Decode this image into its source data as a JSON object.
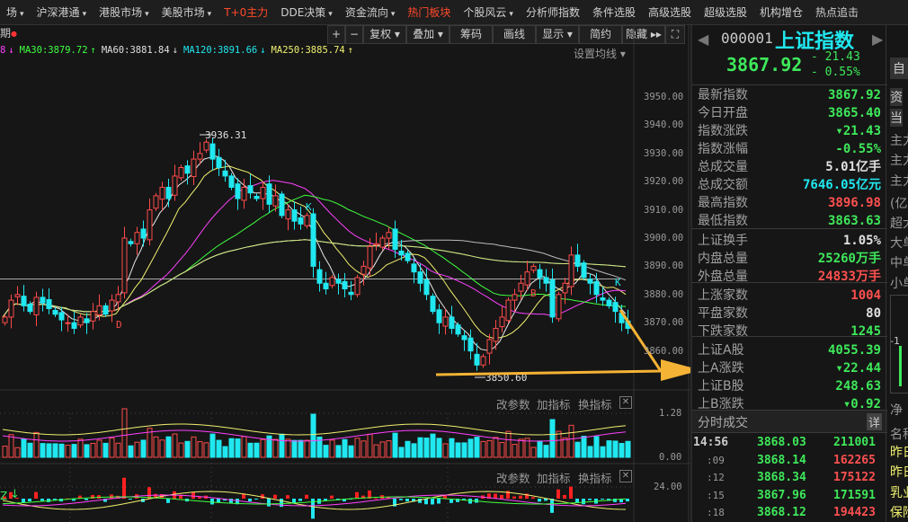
{
  "menu": [
    "场",
    "沪深港通",
    "港股市场",
    "美股市场",
    "T+0主力",
    "DDE决策",
    "资金流向",
    "热门板块",
    "个股风云",
    "分析师指数",
    "条件选股",
    "高级选股",
    "超级选股",
    "机构增仓",
    "热点追击"
  ],
  "menu_dropdown": [
    true,
    true,
    true,
    true,
    false,
    true,
    true,
    false,
    true,
    false,
    false,
    false,
    false,
    false,
    false
  ],
  "menu_highlight": [
    4,
    7
  ],
  "toolbar": {
    "period": "期",
    "plus": "+",
    "minus": "−",
    "fuquan": "复权",
    "overlay": "叠加",
    "chips": "筹码",
    "draw": "画线",
    "display": "显示",
    "simple": "简约",
    "hide": "隐藏",
    "set_ma": "设置均线"
  },
  "ma_legend": [
    {
      "text": "8",
      "color": "#ff40ff",
      "arrow": "↓"
    },
    {
      "text": "MA30:3879.72",
      "color": "#40ff40",
      "arrow": "↑"
    },
    {
      "text": "MA60:3881.84",
      "color": "#e0e0e0",
      "arrow": "↓"
    },
    {
      "text": "MA120:3891.66",
      "color": "#20e8f0",
      "arrow": "↓"
    },
    {
      "text": "MA250:3885.74",
      "color": "#f0f070",
      "arrow": "↑"
    }
  ],
  "price_axis": [
    "3950.00",
    "3940.00",
    "3930.00",
    "3920.00",
    "3910.00",
    "3900.00",
    "3890.00",
    "3880.00",
    "3870.00",
    "3860.00"
  ],
  "chart_data": {
    "type": "candlestick",
    "closes": [
      3872,
      3878,
      3880,
      3876,
      3874,
      3879,
      3877,
      3875,
      3873,
      3871,
      3870,
      3868,
      3872,
      3870,
      3874,
      3876,
      3873,
      3878,
      3880,
      3900,
      3898,
      3902,
      3900,
      3910,
      3915,
      3918,
      3914,
      3922,
      3925,
      3923,
      3928,
      3930,
      3934,
      3928,
      3925,
      3922,
      3918,
      3914,
      3918,
      3916,
      3914,
      3918,
      3912,
      3915,
      3908,
      3910,
      3906,
      3905,
      3908,
      3890,
      3884,
      3882,
      3886,
      3884,
      3882,
      3880,
      3886,
      3890,
      3897,
      3898,
      3900,
      3902,
      3896,
      3894,
      3892,
      3888,
      3884,
      3880,
      3874,
      3870,
      3872,
      3868,
      3866,
      3864,
      3860,
      3855,
      3858,
      3864,
      3868,
      3872,
      3878,
      3880,
      3884,
      3888,
      3890,
      3886,
      3884,
      3872,
      3880,
      3884,
      3894,
      3890,
      3886,
      3884,
      3880,
      3878,
      3876,
      3874,
      3870,
      3868
    ],
    "ylim": [
      3850,
      3955
    ],
    "high_label": "3936.31",
    "low_label": "3850.60",
    "markers": [
      "D",
      "K",
      "K",
      "B"
    ]
  },
  "volume_panel": {
    "axis_top": "1.28",
    "axis_bottom": "0.00",
    "btn_params": "改参数",
    "btn_add": "加指标",
    "btn_switch": "换指标",
    "close": "✕"
  },
  "indicator_panel": {
    "axis_top": "24.00",
    "btn_params": "改参数",
    "btn_add": "加指标",
    "btn_switch": "换指标",
    "close": "✕",
    "left_label": "Z"
  },
  "quote": {
    "code": "000001",
    "name": "上证指数",
    "price": "3867.92",
    "change": "- 21.43",
    "pct": "- 0.55%"
  },
  "stats": [
    {
      "label": "最新指数",
      "value": "3867.92",
      "cls": "g"
    },
    {
      "label": "今日开盘",
      "value": "3865.40",
      "cls": "g"
    },
    {
      "label": "指数涨跌",
      "value": "▾21.43",
      "cls": "g"
    },
    {
      "label": "指数涨幅",
      "value": "-0.55%",
      "cls": "g"
    },
    {
      "label": "总成交量",
      "value": "5.01亿手",
      "cls": "w"
    },
    {
      "label": "总成交额",
      "value": "7646.05亿元",
      "cls": "c"
    },
    {
      "label": "最高指数",
      "value": "3896.98",
      "cls": "r"
    },
    {
      "label": "最低指数",
      "value": "3863.63",
      "cls": "g"
    },
    {
      "label": "上证换手",
      "value": "1.05%",
      "cls": "w"
    },
    {
      "label": "内盘总量",
      "value": "25260万手",
      "cls": "g"
    },
    {
      "label": "外盘总量",
      "value": "24833万手",
      "cls": "r"
    },
    {
      "label": "上涨家数",
      "value": "1004",
      "cls": "r"
    },
    {
      "label": "平盘家数",
      "value": "80",
      "cls": "w"
    },
    {
      "label": "下跌家数",
      "value": "1245",
      "cls": "g"
    },
    {
      "label": "上证A股",
      "value": "4055.39",
      "cls": "g"
    },
    {
      "label": "上A涨跌",
      "value": "▾22.44",
      "cls": "g"
    },
    {
      "label": "上证B股",
      "value": "248.63",
      "cls": "g"
    },
    {
      "label": "上B涨跌",
      "value": "▾0.92",
      "cls": "g"
    }
  ],
  "ticks_header": {
    "title": "分时成交",
    "detail": "详"
  },
  "ticks": [
    {
      "time": "14:56",
      "price": "3868.03",
      "vol": "211001",
      "vcls": "g"
    },
    {
      "time": ":09",
      "price": "3868.14",
      "vol": "162265",
      "vcls": "r"
    },
    {
      "time": ":12",
      "price": "3868.34",
      "vol": "175122",
      "vcls": "r"
    },
    {
      "time": ":15",
      "price": "3867.96",
      "vol": "171591",
      "vcls": "g"
    },
    {
      "time": ":18",
      "price": "3868.12",
      "vol": "194423",
      "vcls": "r"
    }
  ],
  "far_panel": {
    "auto": "自",
    "items": [
      "资",
      "当",
      "主力",
      "主力",
      "主力",
      "(亿元",
      "超大",
      "大单",
      "中单",
      "小单",
      "-1",
      "净",
      "名称",
      "昨日",
      "昨日",
      "乳业",
      "保险"
    ]
  }
}
